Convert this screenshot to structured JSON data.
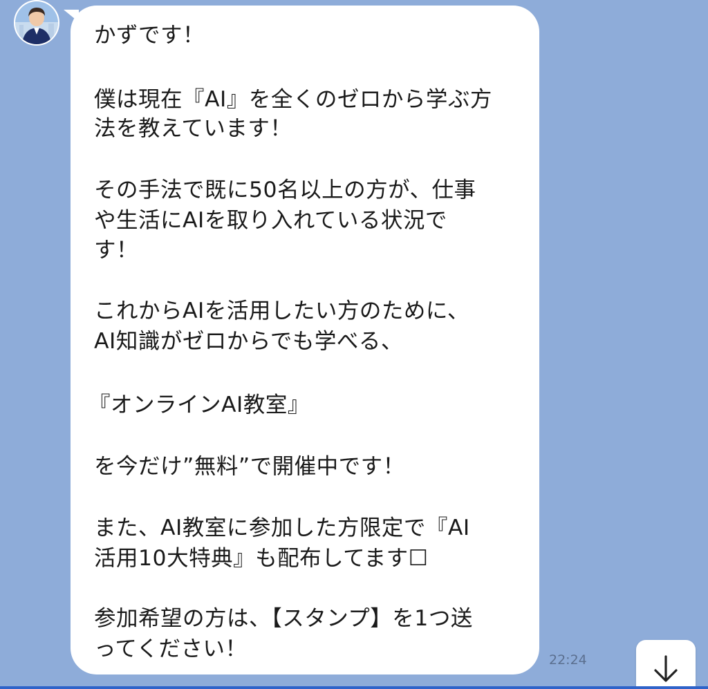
{
  "message": {
    "lines": [
      "かずです！",
      "",
      "僕は現在『AI』を全くのゼロから学ぶ方",
      "法を教えています！",
      "",
      "その手法で既に50名以上の方が、仕事",
      "や生活にAIを取り入れている状況で",
      "す！",
      "",
      "これからAIを活用したい方のために、",
      "AI知識がゼロからでも学べる、",
      "",
      "『オンラインAI教室』",
      "",
      "を今だけ”無料”で開催中です！",
      "",
      "また、AI教室に参加した方限定で『AI",
      "活用10大特典』も配布してます☐",
      "",
      "参加希望の方は、【スタンプ】を1つ送",
      "ってください！"
    ],
    "time": "22:24"
  },
  "icons": {
    "avatar": "user-avatar",
    "scroll": "arrow-down-icon"
  },
  "colors": {
    "background": "#8eacd9",
    "bubble": "#ffffff",
    "text": "#1a1a1a",
    "timestamp": "#5b6f8f",
    "bottom_bar": "#2f63c9"
  }
}
